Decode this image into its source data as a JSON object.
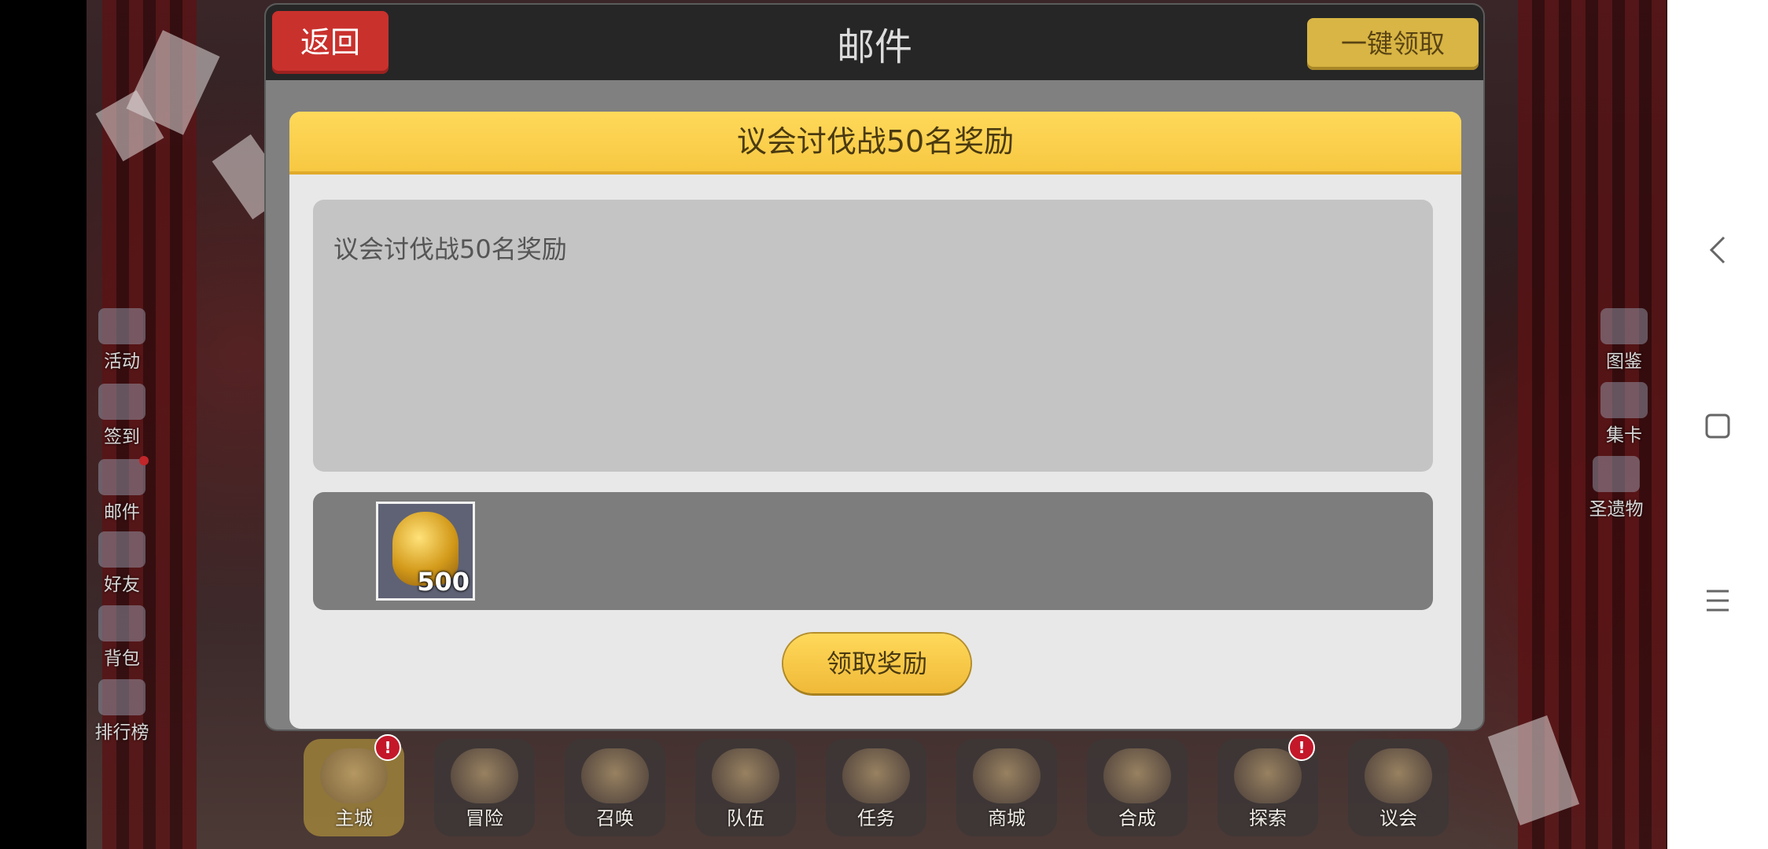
{
  "dialog": {
    "title": "邮件",
    "back_label": "返回",
    "claim_all_label": "一键领取"
  },
  "mail": {
    "title": "议会讨伐战50名奖励",
    "body": "议会讨伐战50名奖励",
    "reward_quantity": "500",
    "claim_label": "领取奖励"
  },
  "left_menu": [
    {
      "label": "活动",
      "icon": "megaphone-icon"
    },
    {
      "label": "签到",
      "icon": "calendar-icon"
    },
    {
      "label": "邮件",
      "icon": "envelope-icon"
    },
    {
      "label": "好友",
      "icon": "friends-icon"
    },
    {
      "label": "背包",
      "icon": "backpack-icon"
    },
    {
      "label": "排行榜",
      "icon": "bar-chart-icon"
    }
  ],
  "right_menu": [
    {
      "label": "图鉴",
      "icon": "book-icon"
    },
    {
      "label": "集卡",
      "icon": "card-icon"
    },
    {
      "label": "圣遗物",
      "icon": "relic-icon"
    }
  ],
  "bottom_nav": [
    {
      "label": "主城",
      "alert": "!"
    },
    {
      "label": "冒险"
    },
    {
      "label": "召唤"
    },
    {
      "label": "队伍"
    },
    {
      "label": "任务"
    },
    {
      "label": "商城"
    },
    {
      "label": "合成"
    },
    {
      "label": "探索",
      "alert": "!"
    },
    {
      "label": "议会"
    }
  ],
  "system_nav": {
    "back_icon": "chevron-left-icon",
    "home_icon": "square-icon",
    "menu_icon": "hamburger-icon"
  }
}
